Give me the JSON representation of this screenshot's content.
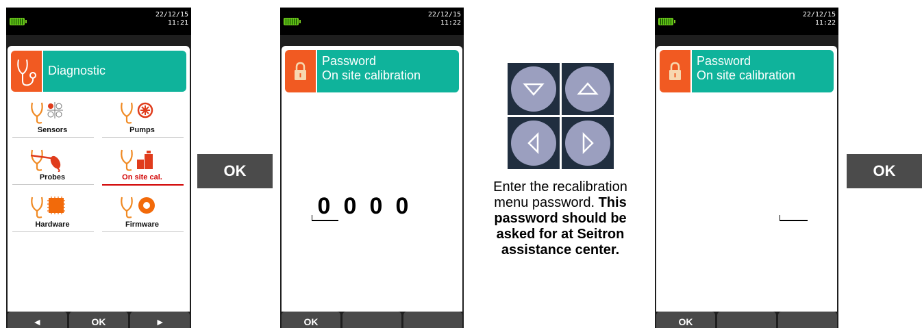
{
  "screen1": {
    "date": "22/12/15",
    "time": "11:21",
    "title": "Diagnostic",
    "items": [
      {
        "label": "Sensors"
      },
      {
        "label": "Pumps"
      },
      {
        "label": "Probes"
      },
      {
        "label": "On site cal."
      },
      {
        "label": "Hardware"
      },
      {
        "label": "Firmware"
      }
    ],
    "softkeys": [
      "◄",
      "OK",
      "►"
    ]
  },
  "ok_left": "OK",
  "screen2": {
    "date": "22/12/15",
    "time": "11:22",
    "title_line1": "Password",
    "title_line2": "On site calibration",
    "digits": [
      "0",
      "0",
      "0",
      "0"
    ],
    "softkeys": [
      "OK",
      "",
      ""
    ]
  },
  "instruction": {
    "plain": "Enter the recalibration menu password.",
    "bold": "This password should be asked for at Seitron assistance center."
  },
  "screen3": {
    "date": "22/12/15",
    "time": "11:22",
    "title_line1": "Password",
    "title_line2": "On site calibration",
    "softkeys": [
      "OK",
      "",
      ""
    ]
  },
  "ok_right": "OK",
  "colors": {
    "accent_green": "#0fb39b",
    "accent_orange": "#f15a22",
    "selected_red": "#d10000",
    "key_blue": "#202e3f"
  }
}
